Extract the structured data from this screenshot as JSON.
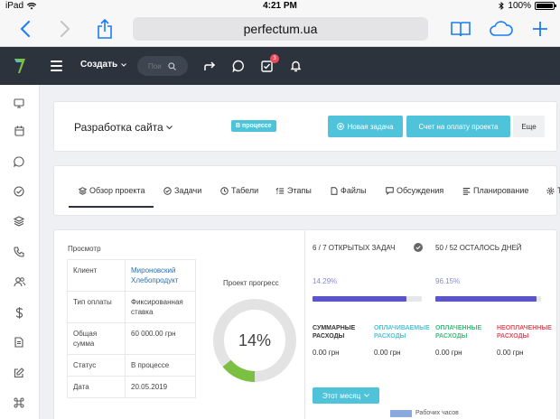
{
  "ios": {
    "device": "iPad",
    "time": "4:21 PM",
    "battery": "100%"
  },
  "browser": {
    "url": "perfectum.ua"
  },
  "topbar": {
    "create_label": "Создать",
    "search_placeholder": "Пои",
    "tasks_badge": "3"
  },
  "project": {
    "title": "Разработка сайта",
    "status": "В процессе",
    "new_task_label": "Новая задача",
    "invoice_label": "Счет на оплату проекта",
    "more_label": "Еще"
  },
  "tabs": [
    {
      "label": "Обзор проекта"
    },
    {
      "label": "Задачи"
    },
    {
      "label": "Табели"
    },
    {
      "label": "Этапы"
    },
    {
      "label": "Файлы"
    },
    {
      "label": "Обсуждения"
    },
    {
      "label": "Планирование"
    },
    {
      "label": "Т"
    }
  ],
  "overview": {
    "section_label": "Просмотр",
    "rows": [
      {
        "key": "Клиент",
        "value": "Мироновский Хлебопродукт"
      },
      {
        "key": "Тип оплаты",
        "value": "Фиксированная ставка"
      },
      {
        "key": "Общая сумма",
        "value": "60 000.00 грн"
      },
      {
        "key": "Статус",
        "value": "В процессе"
      },
      {
        "key": "Дата",
        "value": "20.05.2019"
      }
    ]
  },
  "progress": {
    "title": "Проект прогресс",
    "label": "14%",
    "value": 0.14
  },
  "stats": {
    "tasks_open": "6 / 7 ОТКРЫТЫХ ЗАДАЧ",
    "tasks_pct": "14.29%",
    "tasks_fill": 0.8571,
    "days_left": "50 / 52 ОСТАЛОСЬ ДНЕЙ",
    "days_pct": "96.15%",
    "days_fill": 0.9615
  },
  "expenses": [
    {
      "label": "СУММАРНЫЕ РАСХОДЫ",
      "value": "0.00 грн",
      "color": "#333333"
    },
    {
      "label": "ОПЛАЧИВАЕМЫЕ РАСХОДЫ",
      "value": "0.00 грн",
      "color": "#4fc3da"
    },
    {
      "label": "ОПЛАЧЕННЫЕ РАСХОДЫ",
      "value": "0.00 грн",
      "color": "#3cbf7a"
    },
    {
      "label": "НЕОПЛАЧЕННЫЕ РАСХОДЫ",
      "value": "0.00 грн",
      "color": "#f04a5a"
    }
  ],
  "chart": {
    "period_label": "Этот месяц",
    "legend": "Рабочих часов"
  },
  "colors": {
    "accent": "#4fc3da",
    "topbar": "#2c333d",
    "progress_bar": "#5b55c9",
    "donut_fill": "#7bc043"
  }
}
